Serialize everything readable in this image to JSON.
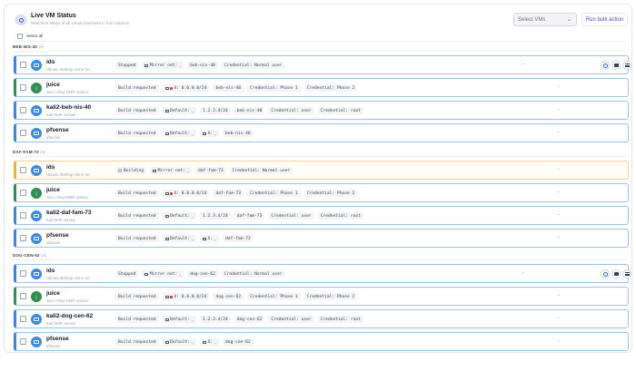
{
  "header": {
    "title": "Live VM Status",
    "subtitle": "Real-time status of all virtual machines in this instance",
    "select_placeholder": "Select VMs",
    "bulk_button": "Run bulk action",
    "select_all_label": "Select all"
  },
  "groups": [
    {
      "name": "BEB-NIS-40",
      "count": "(4)",
      "vms": [
        {
          "name": "ids",
          "desc": "Ubuntu desktop mirror rec",
          "color": "blue",
          "icon": "monitor-icon",
          "status": "Stopped",
          "pills": [
            {
              "text": "Mirror net:",
              "icon": "net",
              "dropdown": true
            },
            {
              "text": "beb-nis-40"
            },
            {
              "text": "Credential: Normal user"
            }
          ],
          "dash": "--",
          "actions": true
        },
        {
          "name": "juice",
          "desc": "Juice Shop NMR version",
          "color": "green",
          "icon": "download-icon",
          "status": "Build requested",
          "pills": [
            {
              "text": "X: 0.0.0.0/24",
              "icon": "net-red"
            },
            {
              "text": "beb-nis-40"
            },
            {
              "text": "Credential: Phase 1"
            },
            {
              "text": "Credential: Phase 2"
            }
          ],
          "dash": "--"
        },
        {
          "name": "kali2-beb-nis-40",
          "desc": "Kali NMR version",
          "color": "blue",
          "icon": "monitor-icon",
          "status": "Build requested",
          "pills": [
            {
              "text": "Default:",
              "icon": "net",
              "dropdown": true
            },
            {
              "text": "1.2.3.4/24"
            },
            {
              "text": "beb-nis-40"
            },
            {
              "text": "Credential: user"
            },
            {
              "text": "Credential: root"
            }
          ],
          "dash": "--"
        },
        {
          "name": "pfsense",
          "desc": "pfSense",
          "color": "blue",
          "icon": "monitor-icon",
          "status": "Build requested",
          "pills": [
            {
              "text": "Default:",
              "icon": "net",
              "dropdown": true
            },
            {
              "text": "X:",
              "icon": "net",
              "dropdown": true
            },
            {
              "text": "beb-nis-40"
            }
          ],
          "dash": "--"
        }
      ]
    },
    {
      "name": "DAF-FAM-73",
      "count": "(4)",
      "vms": [
        {
          "name": "ids",
          "desc": "Ubuntu desktop mirror rec",
          "color": "amber",
          "icon": "monitor-icon",
          "status": "Building",
          "status_icon": true,
          "pills": [
            {
              "text": "Mirror net:",
              "icon": "net",
              "dropdown": true
            },
            {
              "text": "daf-fam-73"
            },
            {
              "text": "Credential: Normal user"
            }
          ],
          "dash": "--"
        },
        {
          "name": "juice",
          "desc": "Juice Shop NMR version",
          "color": "green",
          "icon": "download-icon",
          "status": "Build requested",
          "pills": [
            {
              "text": "X: 0.0.0.0/24",
              "icon": "net-red"
            },
            {
              "text": "daf-fam-73"
            },
            {
              "text": "Credential: Phase 1"
            },
            {
              "text": "Credential: Phase 2"
            }
          ],
          "dash": "--"
        },
        {
          "name": "kali2-daf-fam-73",
          "desc": "Kali NMR version",
          "color": "blue",
          "icon": "monitor-icon",
          "status": "Build requested",
          "pills": [
            {
              "text": "Default:",
              "icon": "net",
              "dropdown": true
            },
            {
              "text": "1.2.3.4/24"
            },
            {
              "text": "daf-fam-73"
            },
            {
              "text": "Credential: user"
            },
            {
              "text": "Credential: root"
            }
          ],
          "dash": "--"
        },
        {
          "name": "pfsense",
          "desc": "pfSense",
          "color": "blue",
          "icon": "monitor-icon",
          "status": "Build requested",
          "pills": [
            {
              "text": "Default:",
              "icon": "net",
              "dropdown": true
            },
            {
              "text": "X:",
              "icon": "net",
              "dropdown": true
            },
            {
              "text": "daf-fam-73"
            }
          ],
          "dash": "--"
        }
      ]
    },
    {
      "name": "DOG-CEN-62",
      "count": "(4)",
      "vms": [
        {
          "name": "ids",
          "desc": "Ubuntu desktop mirror rec",
          "color": "blue",
          "icon": "monitor-icon",
          "status": "Stopped",
          "pills": [
            {
              "text": "Mirror net:",
              "icon": "net",
              "dropdown": true
            },
            {
              "text": "dog-cen-62"
            },
            {
              "text": "Credential: Normal user"
            }
          ],
          "dash": "--",
          "actions": true
        },
        {
          "name": "juice",
          "desc": "Juice Shop NMR version",
          "color": "green",
          "icon": "download-icon",
          "status": "Build requested",
          "pills": [
            {
              "text": "X: 0.0.0.0/24",
              "icon": "net-red"
            },
            {
              "text": "dog-cen-62"
            },
            {
              "text": "Credential: Phase 1"
            },
            {
              "text": "Credential: Phase 2"
            }
          ],
          "dash": "--"
        },
        {
          "name": "kali2-dog-cen-62",
          "desc": "Kali NMR version",
          "color": "blue",
          "icon": "monitor-icon",
          "status": "Build requested",
          "pills": [
            {
              "text": "Default:",
              "icon": "net",
              "dropdown": true
            },
            {
              "text": "1.2.3.4/24"
            },
            {
              "text": "dog-cen-62"
            },
            {
              "text": "Credential: user"
            },
            {
              "text": "Credential: root"
            }
          ],
          "dash": "--"
        },
        {
          "name": "pfsense",
          "desc": "pfSense",
          "color": "blue",
          "icon": "monitor-icon",
          "status": "Build requested",
          "pills": [
            {
              "text": "Default:",
              "icon": "net",
              "dropdown": true
            },
            {
              "text": "X:",
              "icon": "net",
              "dropdown": true
            },
            {
              "text": "dog-cen-62"
            }
          ],
          "dash": "--"
        }
      ]
    }
  ],
  "colors": {
    "accent": "#4f46e5",
    "blue": "#3b82f6",
    "green": "#2f8f4e",
    "amber": "#e8b730"
  }
}
